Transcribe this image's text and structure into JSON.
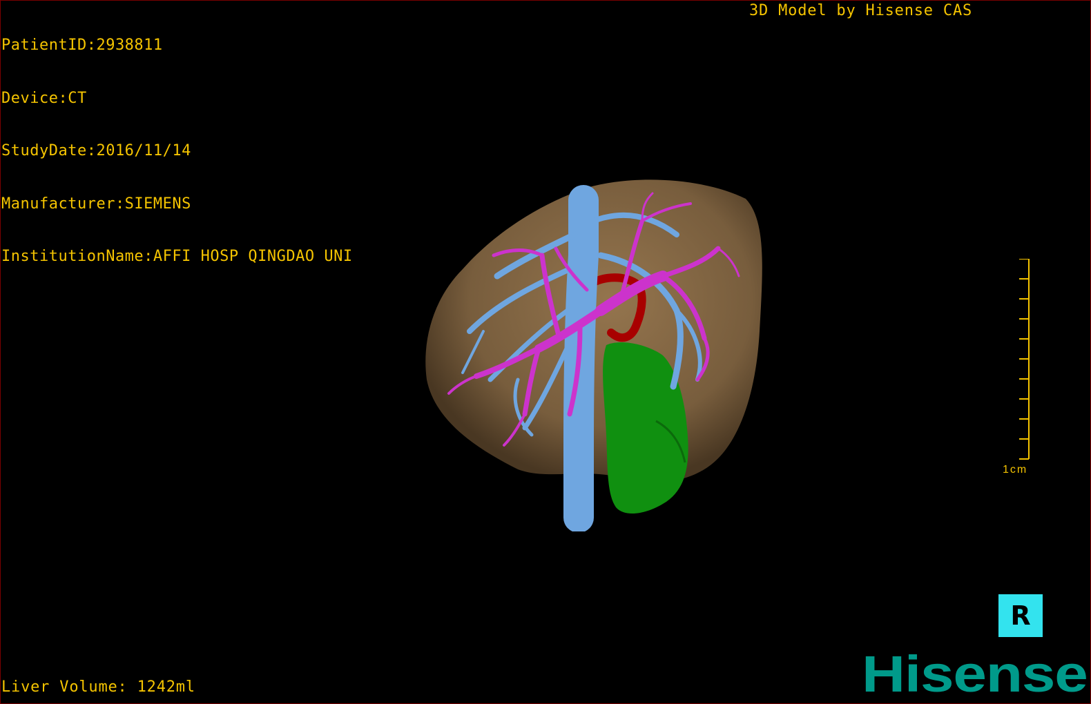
{
  "info": {
    "patient_id": "PatientID:2938811",
    "device": "Device:CT",
    "study_date": "StudyDate:2016/11/14",
    "manufacturer": "Manufacturer:SIEMENS",
    "institution": "InstitutionName:AFFI HOSP QINGDAO UNI"
  },
  "header_right": "3D Model by Hisense CAS",
  "liver_volume": "Liver Volume: 1242ml",
  "scale_bar": {
    "label": "1cm",
    "ticks": 11
  },
  "orientation_button": {
    "icon": "orientation-R-icon",
    "glyph": "R"
  },
  "logo": "Hisense",
  "colors": {
    "overlay_text": "#f5c400",
    "liver": "#8a6b45",
    "hepatic_vein": "#6fa6e0",
    "portal_vein": "#cc33cc",
    "artery": "#a80000",
    "tumor": "#109010",
    "orientation_bg": "#33e3ee",
    "logo": "#009a8a"
  }
}
